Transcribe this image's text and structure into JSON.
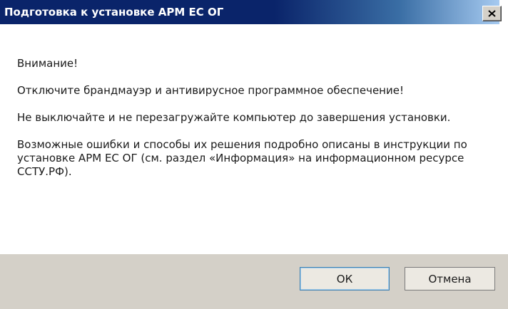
{
  "window": {
    "title": "Подготовка к установке АРМ ЕС ОГ",
    "close_icon": "close-icon"
  },
  "message": {
    "attention": "Внимание!",
    "line1": "Отключите брандмауэр и антивирусное программное обеспечение!",
    "line2": "Не выключайте и не перезагружайте компьютер до завершения установки.",
    "line3": "Возможные ошибки и способы их решения подробно описаны в инструкции по установке АРМ ЕС ОГ (см. раздел «Информация» на информационном ресурсе ССТУ.РФ)."
  },
  "buttons": {
    "ok": "ОК",
    "cancel": "Отмена"
  },
  "colors": {
    "title_bar": "#0a246a",
    "title_bar_end": "#a6caf0",
    "footer": "#d4d0c8",
    "default_button_border": "#3c7fb1"
  }
}
